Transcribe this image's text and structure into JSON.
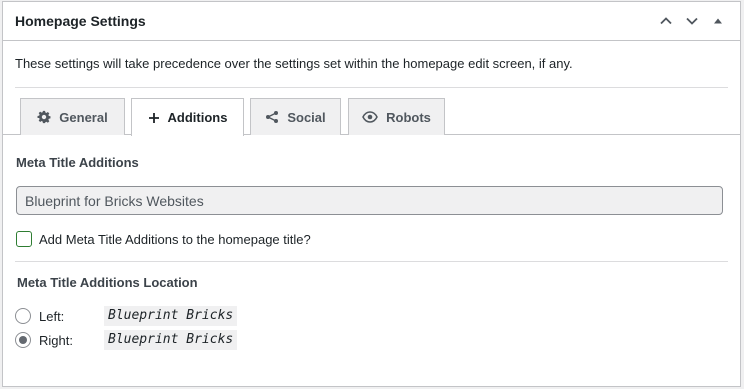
{
  "panel": {
    "title": "Homepage Settings",
    "controls": [
      "chevron-up-icon",
      "chevron-down-icon",
      "triangle-up-icon"
    ]
  },
  "description": "These settings will take precedence over the settings set within the homepage edit screen, if any.",
  "tabs": [
    {
      "label": "General",
      "icon": "gear-icon",
      "active": false
    },
    {
      "label": "Additions",
      "icon": "plus-icon",
      "active": true
    },
    {
      "label": "Social",
      "icon": "share-icon",
      "active": false
    },
    {
      "label": "Robots",
      "icon": "eye-icon",
      "active": false
    }
  ],
  "additions": {
    "meta_title_label": "Meta Title Additions",
    "meta_title_value": "Blueprint for Bricks Websites",
    "checkbox_label": "Add Meta Title Additions to the homepage title?",
    "checkbox_checked": false,
    "location_label": "Meta Title Additions Location",
    "options": [
      {
        "label": "Left:",
        "preview": "Blueprint Bricks",
        "checked": false
      },
      {
        "label": "Right:",
        "preview": "Blueprint Bricks",
        "checked": true
      }
    ]
  },
  "colors": {
    "border": "#c3c4c7",
    "checkbox_accent": "#2e7d32",
    "tab_inactive_bg": "#f0f0f1"
  }
}
